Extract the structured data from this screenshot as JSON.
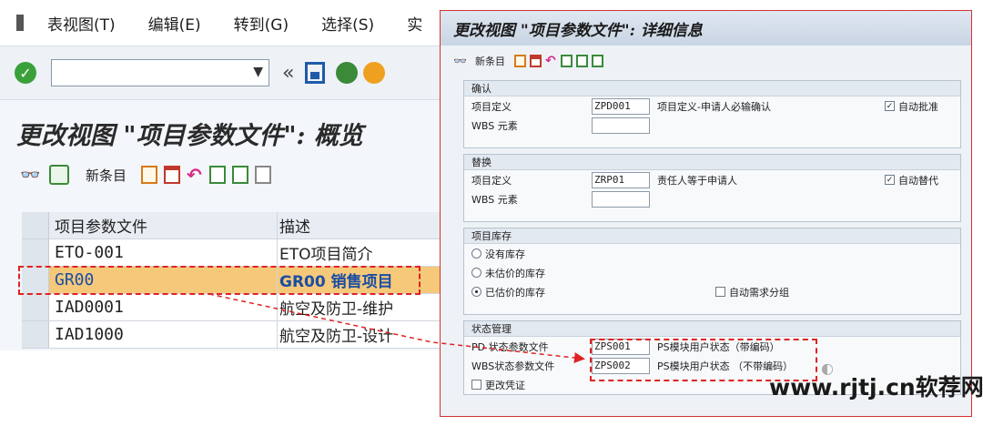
{
  "left": {
    "menu": [
      "表视图(T)",
      "编辑(E)",
      "转到(G)",
      "选择(S)",
      "实"
    ],
    "toolbar": {
      "back_symbol": "«"
    },
    "title": "更改视图 \"项目参数文件\": 概览",
    "app_toolbar": {
      "new_entry": "新条目"
    },
    "table": {
      "headers": [
        "项目参数文件",
        "描述"
      ],
      "rows": [
        {
          "id": "ETO-001",
          "desc": "ETO项目简介"
        },
        {
          "id": "GR00",
          "desc": "GR00 销售项目"
        },
        {
          "id": "IAD0001",
          "desc": "航空及防卫-维护"
        },
        {
          "id": "IAD1000",
          "desc": "航空及防卫-设计"
        }
      ],
      "selected_index": 1
    }
  },
  "popup": {
    "title": "更改视图 \"项目参数文件\": 详细信息",
    "new_entry": "新条目",
    "groups": {
      "confirm": {
        "title": "确认",
        "proj_label": "项目定义",
        "proj_value": "ZPD001",
        "proj_desc": "项目定义-申请人必输确认",
        "auto_label": "自动批准",
        "auto_checked": "✓",
        "wbs_label": "WBS 元素"
      },
      "replace": {
        "title": "替换",
        "proj_label": "项目定义",
        "proj_value": "ZRP01",
        "proj_desc": "责任人等于申请人",
        "auto_label": "自动替代",
        "auto_checked": "✓",
        "wbs_label": "WBS 元素"
      },
      "stock": {
        "title": "项目库存",
        "opt1": "没有库存",
        "opt2": "未估价的库存",
        "opt3": "已估价的库存",
        "auto_req": "自动需求分组"
      },
      "status": {
        "title": "状态管理",
        "pd_label": "PD 状态参数文件",
        "pd_value": "ZPS001",
        "pd_desc": "PS模块用户状态（带编码）",
        "wbs_label": "WBS状态参数文件",
        "wbs_value": "ZPS002",
        "wbs_desc": "PS模块用户状态 （不带编码）",
        "change_doc": "更改凭证"
      }
    }
  },
  "watermark": "www.rjtj.cn软荐网",
  "colors": {
    "accent": "#e02222",
    "selected_row": "#f5c87a",
    "link_text": "#1a4ea3"
  }
}
